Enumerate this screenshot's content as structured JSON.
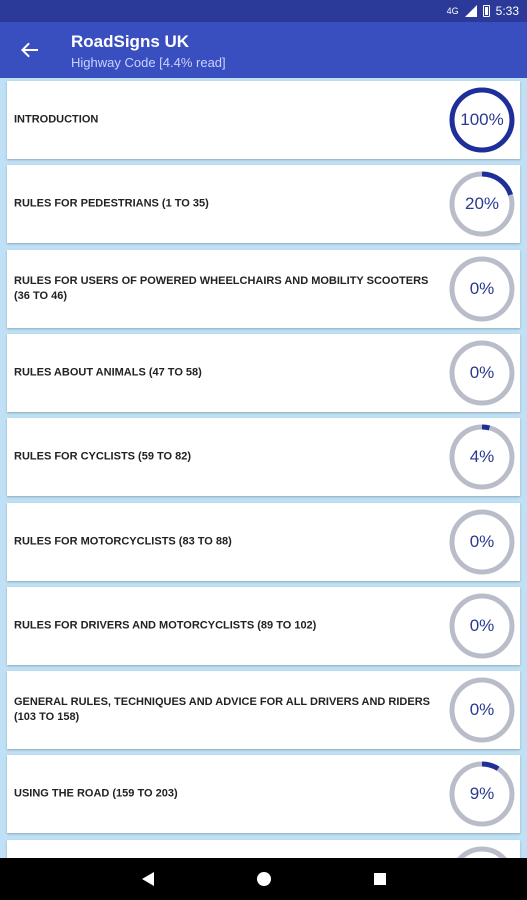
{
  "status": {
    "time": "5:33",
    "network": "4G"
  },
  "app_bar": {
    "title": "RoadSigns UK",
    "subtitle": "Highway Code [4.4% read]"
  },
  "colors": {
    "accent": "#1f2f9a",
    "track": "#b9bdc9",
    "app_bar": "#3a4fbf"
  },
  "sections": [
    {
      "label": "INTRODUCTION",
      "percent_text": "100%",
      "progress": 1.0
    },
    {
      "label": "RULES FOR PEDESTRIANS (1 TO 35)",
      "percent_text": "20%",
      "progress": 0.2
    },
    {
      "label": "RULES FOR USERS OF POWERED WHEELCHAIRS AND MOBILITY SCOOTERS (36 TO 46)",
      "percent_text": "0%",
      "progress": 0
    },
    {
      "label": "RULES ABOUT ANIMALS (47 TO 58)",
      "percent_text": "0%",
      "progress": 0
    },
    {
      "label": "RULES FOR CYCLISTS (59 TO 82)",
      "percent_text": "4%",
      "progress": 0.04
    },
    {
      "label": "RULES FOR MOTORCYCLISTS (83 TO 88)",
      "percent_text": "0%",
      "progress": 0
    },
    {
      "label": "RULES FOR DRIVERS AND MOTORCYCLISTS (89 TO 102)",
      "percent_text": "0%",
      "progress": 0
    },
    {
      "label": "GENERAL RULES, TECHNIQUES AND ADVICE FOR ALL DRIVERS AND RIDERS (103 TO 158)",
      "percent_text": "0%",
      "progress": 0
    },
    {
      "label": "USING THE ROAD (159 TO 203)",
      "percent_text": "9%",
      "progress": 0.09
    },
    {
      "label": "",
      "percent_text": "",
      "progress": 0
    }
  ]
}
